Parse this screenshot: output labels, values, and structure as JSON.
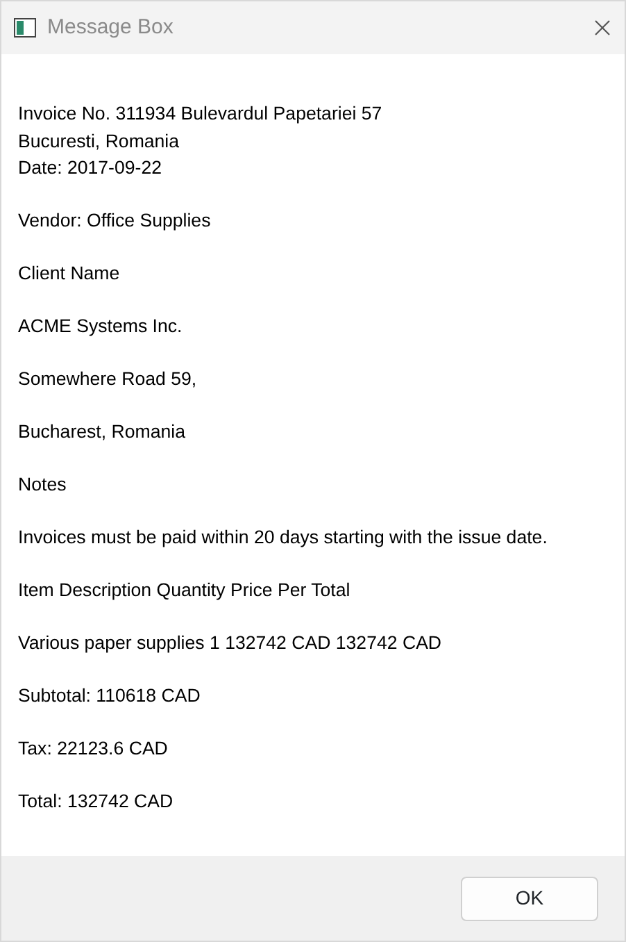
{
  "window": {
    "title": "Message Box"
  },
  "paragraphs": [
    {
      "lines": [
        "Invoice No. 311934 Bulevardul Papetariei 57",
        "Bucuresti, Romania",
        "Date: 2017-09-22"
      ]
    },
    {
      "lines": [
        "Vendor: Office Supplies"
      ]
    },
    {
      "lines": [
        "Client Name"
      ]
    },
    {
      "lines": [
        "ACME Systems Inc."
      ]
    },
    {
      "lines": [
        "Somewhere Road 59,"
      ]
    },
    {
      "lines": [
        "Bucharest, Romania"
      ]
    },
    {
      "lines": [
        "Notes"
      ]
    },
    {
      "lines": [
        "Invoices must be paid within 20 days starting with the issue date."
      ]
    },
    {
      "lines": [
        "Item Description Quantity Price Per Total"
      ]
    },
    {
      "lines": [
        "Various paper supplies 1 132742 CAD 132742 CAD"
      ]
    },
    {
      "lines": [
        "Subtotal: 110618 CAD"
      ]
    },
    {
      "lines": [
        "Tax: 22123.6 CAD"
      ]
    },
    {
      "lines": [
        "Total: 132742 CAD"
      ]
    }
  ],
  "buttons": [
    "OK"
  ]
}
